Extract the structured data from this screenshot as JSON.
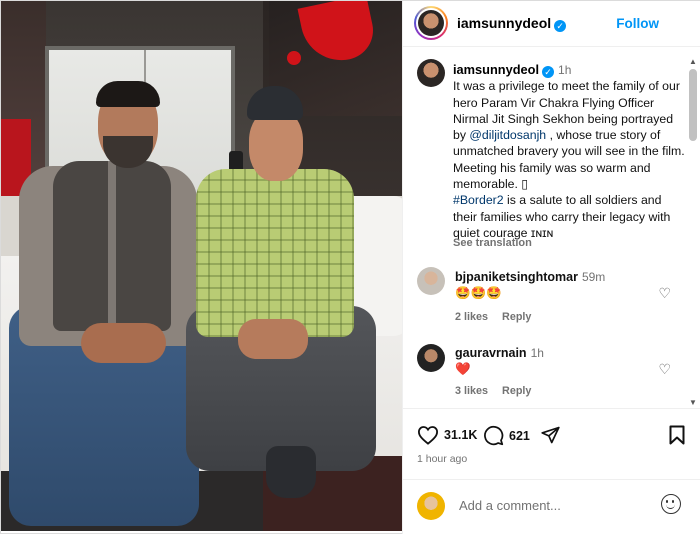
{
  "post": {
    "username": "iamsunnydeol",
    "follow_label": "Follow",
    "close_glyph": "✕",
    "caption": {
      "time": "1h",
      "text_part1": "It was a privilege to meet the family of our hero Param Vir Chakra Flying Officer Nirmal Jit Singh Sekhon being portrayed by ",
      "mention": "@diljitdosanjh",
      "text_part2": " , whose true story of unmatched bravery you will see in the film. Meeting his family was so warm and memorable. ▯",
      "hashtag": "#Border2",
      "text_part3": " is a salute to all soldiers and their families who carry their legacy with quiet courage ɪɴɪɴ",
      "see_translation": "See translation"
    },
    "comments": [
      {
        "username": "bjpaniketsinghtomar",
        "time": "59m",
        "text": "🤩🤩🤩",
        "likes": "2 likes",
        "reply": "Reply"
      },
      {
        "username": "gauravrnain",
        "time": "1h",
        "text": "❤️",
        "likes": "3 likes",
        "reply": "Reply"
      }
    ],
    "actions": {
      "like_count": "31.1K",
      "comment_count": "621",
      "time_ago": "1 hour ago"
    },
    "add_comment_placeholder": "Add a comment..."
  },
  "icons": {
    "verified": "verified-badge-icon",
    "like": "heart-icon",
    "comment": "comment-bubble-icon",
    "share": "paper-plane-icon",
    "save": "bookmark-icon",
    "emoji": "smiley-icon"
  },
  "colors": {
    "accent": "#0095f6",
    "link": "#00376b",
    "muted": "#737373",
    "heart_red": "#ed4956"
  }
}
